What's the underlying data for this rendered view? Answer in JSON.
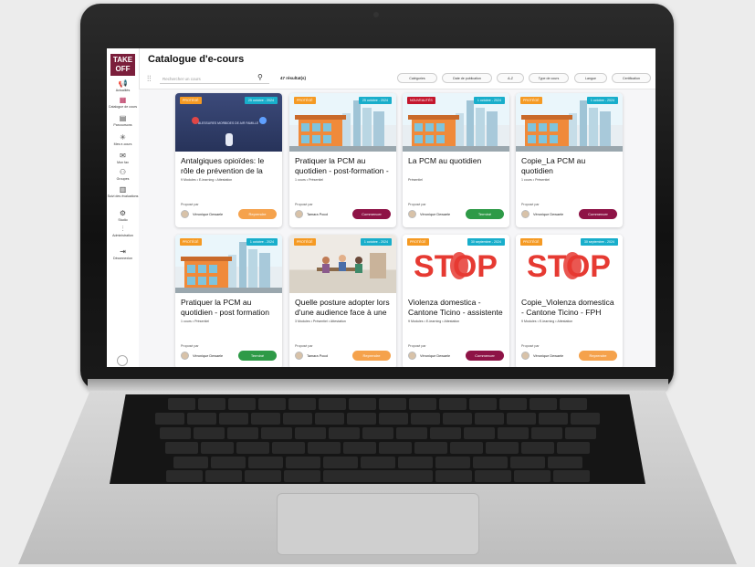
{
  "app": {
    "logo_text": "TAKE OFF",
    "page_title": "Catalogue d'e-cours"
  },
  "sidebar": {
    "items": [
      {
        "label": "Actualités",
        "icon": "megaphone-icon"
      },
      {
        "label": "Catalogue de cours",
        "icon": "catalog-icon"
      },
      {
        "label": "Parcoursons",
        "icon": "book-icon"
      },
      {
        "label": "Mes e-cours",
        "icon": "sparkle-icon"
      },
      {
        "label": "Mon fax",
        "icon": "mail-icon"
      },
      {
        "label": "Groupes",
        "icon": "group-icon"
      },
      {
        "label": "Suivi des évaluations",
        "icon": "evaluation-icon"
      },
      {
        "label": "Studio",
        "icon": "gear-icon"
      },
      {
        "label": "Administration",
        "icon": "sliders-icon"
      },
      {
        "label": "Déconnexion",
        "icon": "logout-icon"
      }
    ]
  },
  "toolbar": {
    "search_placeholder": "Rechercher un cours",
    "results": "47 résultat(s)",
    "filters": [
      "Catégories",
      "Date de publication",
      "A-Z",
      "Type de cours",
      "Langue",
      "Certification"
    ]
  },
  "cards": [
    {
      "status": "PROTÉGÉ",
      "status_color": "#f59a23",
      "date": "25 octobre - 2024",
      "title": "Antalgiques opioïdes: le rôle de prévention de la",
      "meta": [
        "9 Modules",
        "E-learning",
        "Attestation"
      ],
      "proposed": "Proposé par",
      "author": "Véronique Dewaele",
      "action": "Reprendre",
      "action_color": "#f5a24c",
      "thumb": "drug"
    },
    {
      "status": "PROTÉGÉ",
      "status_color": "#f59a23",
      "date": "25 octobre - 2024",
      "title": "Pratiquer la PCM au quotidien - post-formation -",
      "meta": [
        "1 cours",
        "Présentiel"
      ],
      "proposed": "Proposé par",
      "author": "Tamara Pocol",
      "action": "Commencer",
      "action_color": "#8e1346",
      "thumb": "city"
    },
    {
      "status": "NOUVEAUTÉS",
      "status_color": "#c4162d",
      "date": "1 octobre - 2024",
      "title": "La PCM au quotidien",
      "meta": [
        "Présentiel"
      ],
      "proposed": "Proposé par",
      "author": "Véronique Dewaele",
      "action": "Terminé",
      "action_color": "#2e9a47",
      "thumb": "city"
    },
    {
      "status": "PROTÉGÉ",
      "status_color": "#f59a23",
      "date": "1 octobre - 2024",
      "title": "Copie_La PCM au quotidien",
      "meta": [
        "1 cours",
        "Présentiel"
      ],
      "proposed": "Proposé par",
      "author": "Véronique Dewaele",
      "action": "Commencer",
      "action_color": "#8e1346",
      "thumb": "city"
    },
    {
      "status": "PROTÉGÉ",
      "status_color": "#f59a23",
      "date": "1 octobre - 2024",
      "title": "Pratiquer la PCM au quotidien - post formation",
      "meta": [
        "1 cours",
        "Présentiel"
      ],
      "proposed": "Proposé par",
      "author": "Véronique Dewaele",
      "action": "Terminé",
      "action_color": "#2e9a47",
      "thumb": "city"
    },
    {
      "status": "PROTÉGÉ",
      "status_color": "#f59a23",
      "date": "1 octobre - 2024",
      "title": "Quelle posture adopter lors d'une audience face à une",
      "meta": [
        "3 Modules",
        "Présentiel",
        "Attestation"
      ],
      "proposed": "Proposé par",
      "author": "Tamara Pocol",
      "action": "Reprendre",
      "action_color": "#f5a24c",
      "thumb": "people"
    },
    {
      "status": "PROTÉGÉ",
      "status_color": "#f59a23",
      "date": "30 septembre - 2024",
      "title": "Violenza domestica - Cantone Ticino - assistente",
      "meta": [
        "9 Modules",
        "E-learning",
        "Attestation"
      ],
      "proposed": "Proposé par",
      "author": "Véronique Dewaele",
      "action": "Commencer",
      "action_color": "#8e1346",
      "thumb": "stop"
    },
    {
      "status": "PROTÉGÉ",
      "status_color": "#f59a23",
      "date": "30 septembre - 2024",
      "title": "Copie_Violenza domestica - Cantone Ticino - FPH",
      "meta": [
        "9 Modules",
        "E-learning",
        "Attestation"
      ],
      "proposed": "Proposé par",
      "author": "Véronique Dewaele",
      "action": "Reprendre",
      "action_color": "#f5a24c",
      "thumb": "stop"
    }
  ],
  "thumb_text": {
    "stop": "STOP",
    "drug_heading": "BLESSURES MORBIDES DE AIR FAMILLE"
  }
}
